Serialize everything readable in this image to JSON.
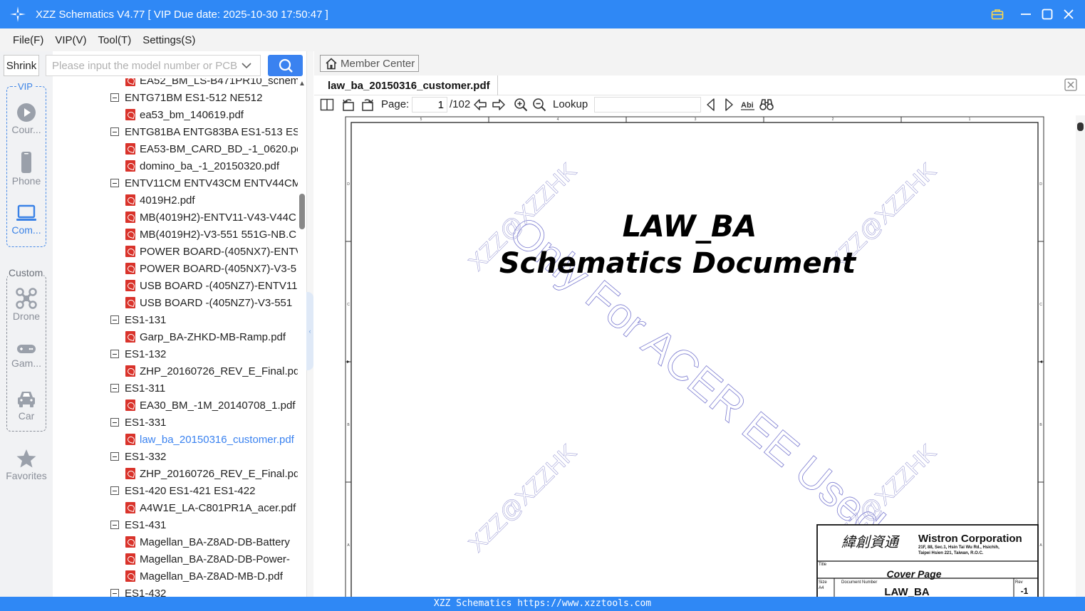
{
  "window": {
    "title": "XZZ Schematics V4.77 [ VIP Due date: 2025-10-30 17:50:47 ]"
  },
  "menu": [
    "File(F)",
    "VIP(V)",
    "Tool(T)",
    "Settings(S)"
  ],
  "left_panel": {
    "shrink_label": "Shrink",
    "search_placeholder": "Please input the model number or PCB",
    "vip_label": "VIP",
    "custom_label": "Custom",
    "favorites_label": "Favorites",
    "vip_items": [
      {
        "label": "Cour...",
        "icon": "play-circle-icon"
      },
      {
        "label": "Phone",
        "icon": "phone-icon"
      },
      {
        "label": "Com...",
        "icon": "laptop-icon",
        "active": true
      }
    ],
    "custom_items": [
      {
        "label": "Drone",
        "icon": "drone-icon"
      },
      {
        "label": "Gam...",
        "icon": "gamepad-icon"
      },
      {
        "label": "Car",
        "icon": "car-icon"
      }
    ]
  },
  "tree": [
    {
      "type": "file",
      "text": "EA52_BM_LS-B471PR10_schem"
    },
    {
      "type": "folder",
      "text": "ENTG71BM ES1-512 NE512"
    },
    {
      "type": "file",
      "text": "ea53_bm_140619.pdf"
    },
    {
      "type": "folder",
      "text": "ENTG81BA ENTG83BA ES1-513 ES1"
    },
    {
      "type": "file",
      "text": "EA53-BM_CARD_BD_-1_0620.pd"
    },
    {
      "type": "file",
      "text": "domino_ba_-1_20150320.pdf"
    },
    {
      "type": "folder",
      "text": "ENTV11CM ENTV43CM ENTV44CM"
    },
    {
      "type": "file",
      "text": "4019H2.pdf"
    },
    {
      "type": "file",
      "text": "MB(4019H2)-ENTV11-V43-V44C"
    },
    {
      "type": "file",
      "text": "MB(4019H2)-V3-551 551G-NB.C"
    },
    {
      "type": "file",
      "text": "POWER BOARD-(405NX7)-ENTV"
    },
    {
      "type": "file",
      "text": "POWER BOARD-(405NX7)-V3-5"
    },
    {
      "type": "file",
      "text": "USB BOARD -(405NZ7)-ENTV11"
    },
    {
      "type": "file",
      "text": "USB BOARD -(405NZ7)-V3-551"
    },
    {
      "type": "folder",
      "text": "ES1-131"
    },
    {
      "type": "file",
      "text": "Garp_BA-ZHKD-MB-Ramp.pdf"
    },
    {
      "type": "folder",
      "text": "ES1-132"
    },
    {
      "type": "file",
      "text": "ZHP_20160726_REV_E_Final.pdf"
    },
    {
      "type": "folder",
      "text": "ES1-311"
    },
    {
      "type": "file",
      "text": "EA30_BM_-1M_20140708_1.pdf"
    },
    {
      "type": "folder",
      "text": "ES1-331"
    },
    {
      "type": "file",
      "text": "law_ba_20150316_customer.pdf",
      "selected": true
    },
    {
      "type": "folder",
      "text": "ES1-332"
    },
    {
      "type": "file",
      "text": "ZHP_20160726_REV_E_Final.pdf"
    },
    {
      "type": "folder",
      "text": "ES1-420 ES1-421 ES1-422"
    },
    {
      "type": "file",
      "text": "A4W1E_LA-C801PR1A_acer.pdf"
    },
    {
      "type": "folder",
      "text": "ES1-431"
    },
    {
      "type": "file",
      "text": "Magellan_BA-Z8AD-DB-Battery"
    },
    {
      "type": "file",
      "text": "Magellan_BA-Z8AD-DB-Power-"
    },
    {
      "type": "file",
      "text": "Magellan_BA-Z8AD-MB-D.pdf"
    },
    {
      "type": "folder",
      "text": "ES1-432"
    }
  ],
  "viewer": {
    "member_center": "Member Center",
    "tab_title": "law_ba_20150316_customer.pdf",
    "page_label": "Page:",
    "page_current": "1",
    "page_total": "/102",
    "lookup_label": "Lookup"
  },
  "document": {
    "title_line1": "LAW_BA",
    "title_line2": "Schematics Document",
    "watermark_main": "Only For ACER EE Used",
    "watermark_small": "XZZ@XZZHK",
    "company_chinese": "緯創資通",
    "company_name": "Wistron Corporation",
    "company_addr1": "21F, 88, Sec.1, Hsin Tai Wu Rd., Hsichih,",
    "company_addr2": "Taipei Hsien 221, Taiwan, R.O.C.",
    "tb_title_label": "Title",
    "tb_title": "Cover Page",
    "tb_size_label": "Size",
    "tb_size": "A4",
    "tb_docnum_label": "Document Number",
    "tb_docnum": "LAW_BA",
    "tb_rev_label": "Rev",
    "tb_rev": "-1",
    "col_marks": [
      "5",
      "4",
      "3",
      "2",
      "1"
    ],
    "row_marks": [
      "D",
      "C",
      "B",
      "A"
    ]
  },
  "footer": "XZZ Schematics https://www.xzztools.com",
  "colors": {
    "accent": "#2f88f5",
    "selected": "#3a82f0",
    "pdf_red": "#d9332b"
  }
}
